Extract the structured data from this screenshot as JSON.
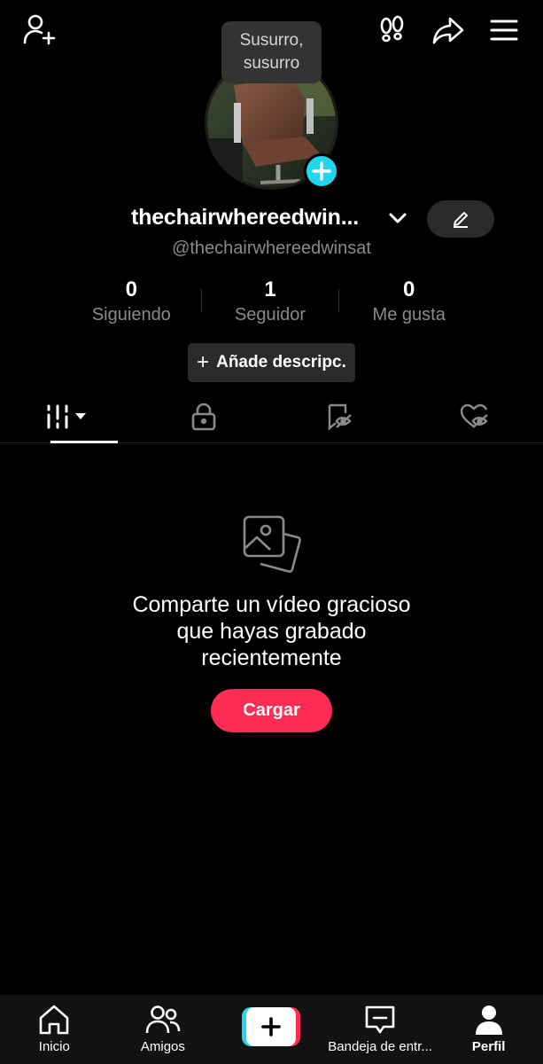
{
  "tooltip": {
    "line1": "Susurro,",
    "line2": "susurro"
  },
  "profile": {
    "display_name": "thechairwhereedwin...",
    "handle": "@thechairwhereedwinsat"
  },
  "stats": [
    {
      "value": "0",
      "label": "Siguiendo"
    },
    {
      "value": "1",
      "label": "Seguidor"
    },
    {
      "value": "0",
      "label": "Me gusta"
    }
  ],
  "add_description": {
    "plus": "+",
    "label": "Añade descripc."
  },
  "tabs": [
    {
      "icon": "grid-icon",
      "selected": true
    },
    {
      "icon": "lock-icon",
      "selected": false
    },
    {
      "icon": "hidden-bookmark-icon",
      "selected": false
    },
    {
      "icon": "hidden-heart-icon",
      "selected": false
    }
  ],
  "empty_state": {
    "line1": "Comparte un vídeo gracioso",
    "line2": "que hayas grabado",
    "line3": "recientemente",
    "button": "Cargar"
  },
  "bottom_nav": [
    {
      "label": "Inicio",
      "icon": "home-icon"
    },
    {
      "label": "Amigos",
      "icon": "friends-icon"
    },
    {
      "label": "",
      "icon": "create-plus-icon"
    },
    {
      "label": "Bandeja de entr...",
      "icon": "inbox-icon"
    },
    {
      "label": "Perfil",
      "icon": "profile-icon",
      "active": true
    }
  ],
  "colors": {
    "background": "#000000",
    "accent_red": "#fe2c55",
    "accent_cyan": "#20d5ec",
    "muted_text": "#8a8a8a"
  }
}
